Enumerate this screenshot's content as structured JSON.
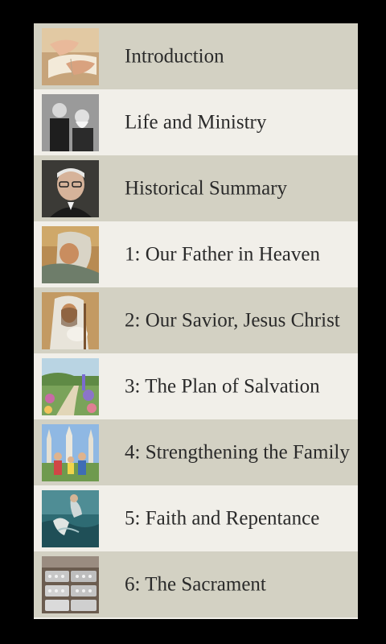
{
  "chapters": [
    {
      "label": "Introduction",
      "image": "hands-reading-book"
    },
    {
      "label": "Life and Ministry",
      "image": "two-men-portrait"
    },
    {
      "label": "Historical Summary",
      "image": "elderly-man-glasses-portrait"
    },
    {
      "label": "1: Our Father in Heaven",
      "image": "painted-bearded-father-figure"
    },
    {
      "label": "2: Our Savior, Jesus Christ",
      "image": "shepherd-with-lamb"
    },
    {
      "label": "3: The Plan of Salvation",
      "image": "garden-path-flowers"
    },
    {
      "label": "4: Strengthening the Family",
      "image": "family-at-temple"
    },
    {
      "label": "5: Faith and Repentance",
      "image": "figure-in-water"
    },
    {
      "label": "6: The Sacrament",
      "image": "sacrament-trays"
    }
  ]
}
